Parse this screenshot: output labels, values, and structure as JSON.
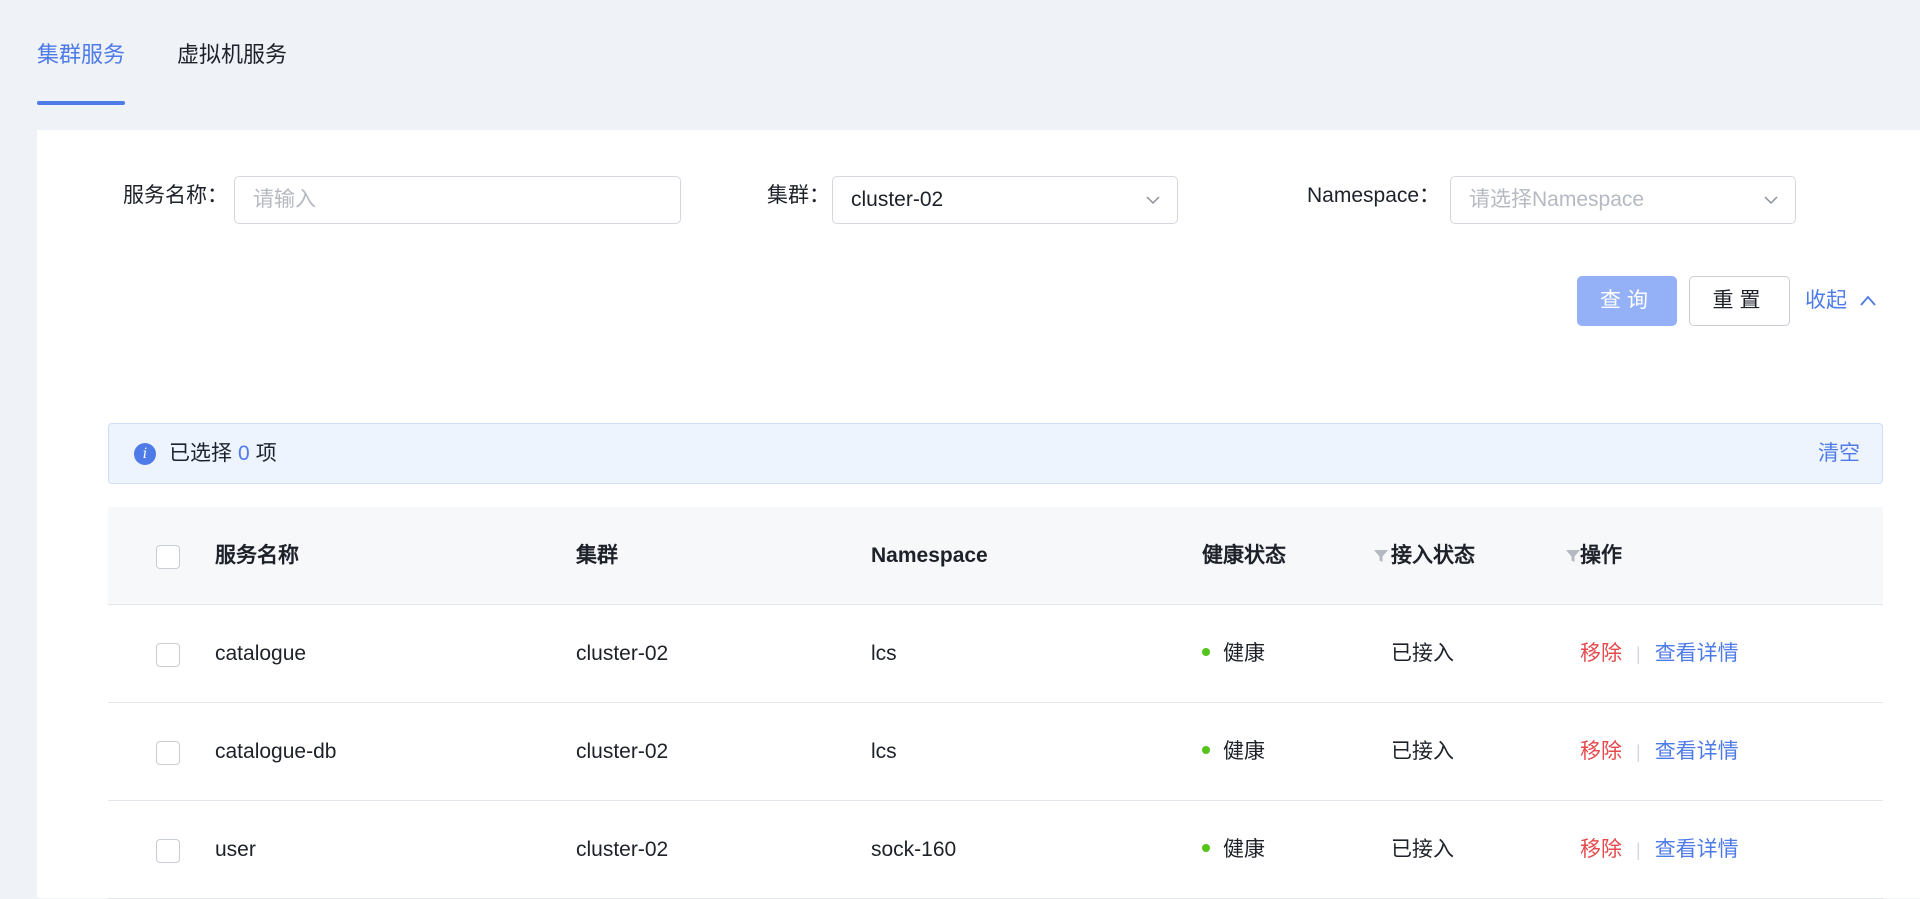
{
  "tabs": [
    {
      "label": "集群服务",
      "active": true
    },
    {
      "label": "虚拟机服务",
      "active": false
    }
  ],
  "filters": {
    "service_name_label": "服务名称：",
    "service_name_placeholder": "请输入",
    "cluster_label": "集群：",
    "cluster_value": "cluster-02",
    "namespace_label": "Namespace：",
    "namespace_placeholder": "请选择Namespace"
  },
  "actions": {
    "query": "查询",
    "reset": "重置",
    "collapse": "收起"
  },
  "alert": {
    "prefix": "已选择",
    "count": "0",
    "suffix": "项",
    "clear": "清空"
  },
  "table": {
    "headers": [
      "服务名称",
      "集群",
      "Namespace",
      "健康状态",
      "接入状态",
      "操作"
    ],
    "rows": [
      {
        "name": "catalogue",
        "cluster": "cluster-02",
        "namespace": "lcs",
        "health": "健康",
        "access": "已接入",
        "remove": "移除",
        "detail": "查看详情"
      },
      {
        "name": "catalogue-db",
        "cluster": "cluster-02",
        "namespace": "lcs",
        "health": "健康",
        "access": "已接入",
        "remove": "移除",
        "detail": "查看详情"
      },
      {
        "name": "user",
        "cluster": "cluster-02",
        "namespace": "sock-160",
        "health": "健康",
        "access": "已接入",
        "remove": "移除",
        "detail": "查看详情"
      }
    ]
  },
  "colors": {
    "accent": "#4e7be8",
    "danger": "#e5484d",
    "healthy": "#52c41a"
  }
}
